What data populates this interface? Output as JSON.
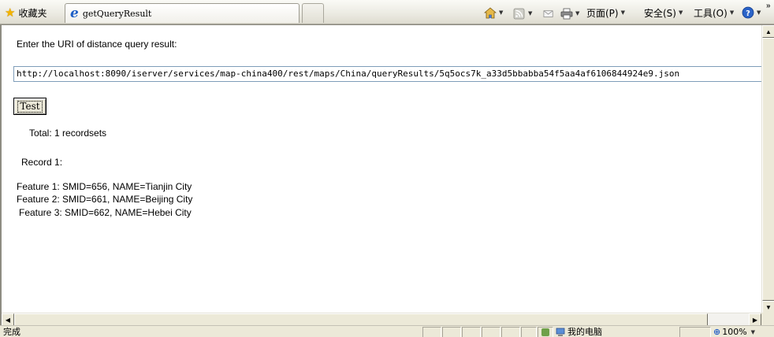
{
  "toolbar": {
    "favorites_label": "收藏夹",
    "tab_title": "getQueryResult",
    "page_menu": "页面(P)",
    "safety_menu": "安全(S)",
    "tools_menu": "工具(O)",
    "overflow": "»"
  },
  "content": {
    "prompt": "Enter the URI of distance query result:",
    "uri_value": "http://localhost:8090/iserver/services/map-china400/rest/maps/China/queryResults/5q5ocs7k_a33d5bbabba54f5aa4af6106844924e9.json",
    "test_button": "Test",
    "total": "Total: 1 recordsets",
    "record": "Record 1:",
    "features": [
      "Feature 1: SMID=656, NAME=Tianjin City",
      "Feature 2: SMID=661, NAME=Beijing City",
      "Feature 3: SMID=662, NAME=Hebei City"
    ]
  },
  "status": {
    "text": "完成",
    "zone": "我的电脑",
    "zoom": "100%"
  },
  "colors": {
    "ie_blue": "#1e5fc6",
    "chrome_bg": "#ece9d8",
    "input_border": "#7f9db9"
  }
}
